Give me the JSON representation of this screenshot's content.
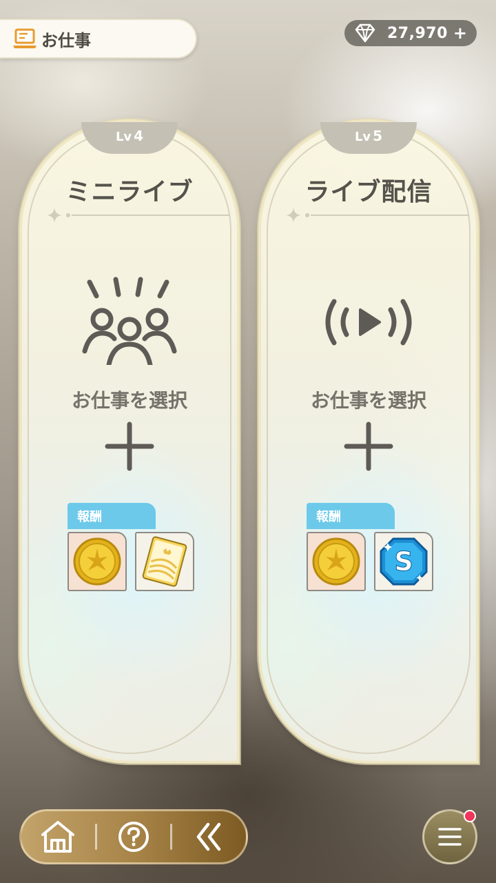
{
  "header": {
    "title": "お仕事",
    "title_icon": "laptop-icon"
  },
  "currency": {
    "icon": "diamond-icon",
    "amount": "27,970",
    "plus_label": "+"
  },
  "jobs": [
    {
      "level_prefix": "Lv",
      "level": "4",
      "title": "ミニライブ",
      "icon": "crowd-icon",
      "select_label": "お仕事を選択",
      "reward_label": "報酬",
      "rewards": [
        "gold-coin-icon",
        "gold-book-icon"
      ]
    },
    {
      "level_prefix": "Lv",
      "level": "5",
      "title": "ライブ配信",
      "icon": "broadcast-icon",
      "select_label": "お仕事を選択",
      "reward_label": "報酬",
      "rewards": [
        "gold-coin-icon",
        "s-badge-icon"
      ]
    }
  ],
  "nav": {
    "items": [
      "home-icon",
      "help-icon",
      "back-icon"
    ],
    "menu": "menu-icon"
  },
  "colors": {
    "reward_tab": "#6cc9ea",
    "nav_gold": "#a88448",
    "notification": "#f0365a"
  }
}
